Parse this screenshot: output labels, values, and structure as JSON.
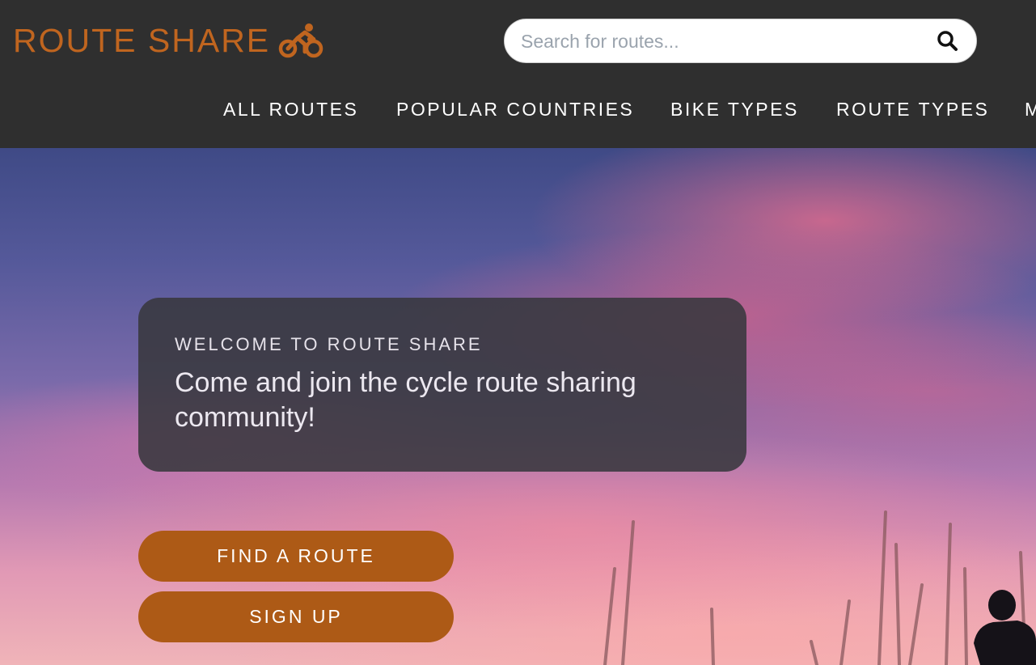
{
  "brand": {
    "name": "ROUTE SHARE",
    "icon": "bicycle-icon",
    "color": "#c0651f"
  },
  "search": {
    "placeholder": "Search for routes...",
    "value": "",
    "icon": "search-icon"
  },
  "nav": {
    "items": [
      {
        "label": "ALL ROUTES"
      },
      {
        "label": "POPULAR COUNTRIES"
      },
      {
        "label": "BIKE TYPES"
      },
      {
        "label": "ROUTE TYPES"
      },
      {
        "label": "M"
      }
    ]
  },
  "hero": {
    "eyebrow": "WELCOME TO ROUTE SHARE",
    "heading": "Come and join the cycle route sharing community!",
    "buttons": {
      "find": "FIND A ROUTE",
      "signup": "SIGN UP"
    },
    "button_color": "#ad5a16"
  },
  "colors": {
    "header_bg": "#2f2f2f",
    "accent": "#c0651f"
  }
}
